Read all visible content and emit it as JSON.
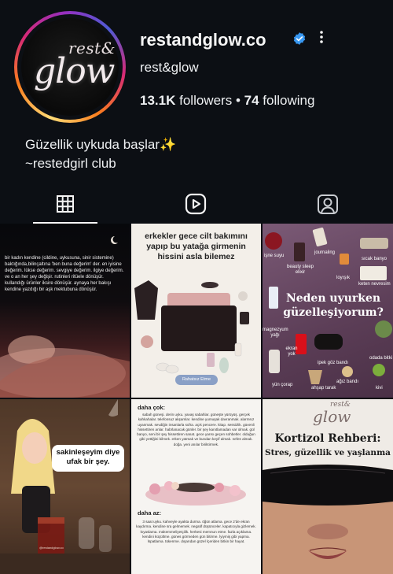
{
  "profile": {
    "username": "restandglow.co",
    "display_name": "rest&glow",
    "followers_count": "13.1K",
    "followers_label": "followers",
    "following_count": "74",
    "following_label": "following",
    "bio_line1": "Güzellik uykuda başlar✨",
    "bio_line2": "~restedgirl club",
    "avatar_logo_top": "rest&",
    "avatar_logo_main": "glow"
  },
  "tabs": [
    {
      "icon": "grid-icon",
      "active": true
    },
    {
      "icon": "reels-icon",
      "active": false
    },
    {
      "icon": "tagged-icon",
      "active": false
    }
  ],
  "posts": {
    "p1_text": "bir kadın kendine (cildine, uykusuna, sinir sistemine) baktığında,bilinçaltına 'ben buna değerim' der. en iyisine değerim. lükse değerim. sevgiye değerim. ilgiye değerim. ve o an her şey değişir. rutinleri ritüele dönüşür. kullandığı ürünler iksire dönüşür. aynaya her bakışı kendine yazdığı bir aşk mektubuna dönüşür.",
    "p2_title": "erkekler gece cilt bakımını yapıp bu yatağa girmenin hissini asla bilemez",
    "p2_button": "Rahatsız Etme",
    "p3_title": "Neden uyurken güzelleşiyorum?",
    "p3_labels": [
      "işne suyu",
      "journaling",
      "sıcak banyo",
      "beauty sleep elixir",
      "loyışık",
      "keten nevresim",
      "magnezyum yağı",
      "ekran yok",
      "ipek göz bandı",
      "odada bitki",
      "yün çorap",
      "ahşap tarak",
      "ağız bandı",
      "kivi"
    ],
    "p4_bubble": "sakinleşeyim diye ufak bir şey.",
    "p4_watermark": "@restandglow.co",
    "p5_heading1": "daha çok:",
    "p5_text1": "sabah güneşi. derin uyku. yavaş sabahlar. güneşte yürüyüş. gerçek kahkahalar. telefonsuz akşamlar. kendine yumuşak davranmak. alarmsız uyanmak. sevdiğin insanlarla sofra. açık pencere. kitap. sessizlik. güvenli hissettiren anlar. habrlanacak günler. bir şey kanıtlamadan var olmak. gül banyo, seni bir şey hissettiren sanat. gece yarısı geçen sohbetler. olduğun gibi yettiğini bilmek. erken yatmak ve bundan keyif almak. nefes almak. doğa. yeni anılar biriktirmek.",
    "p5_heading2": "daha az:",
    "p5_text2": "3 saat uyku. kahveyle ayakta durma. öğün atlama. gece 2'de ekran kaydırma. kendine sra gelmemek. negatif düşünceler. kapatıcıyla gizlemek. kıyaslama. mükemmeliyetçilik. herkesi memnun etme. fazla açıklama. kendini küçültme. günes görmeden gün bitirme. İyiymiş gibi yapma. İspatlama. tükenme. dışarıdan güzel İçeriden bitkin bir hayat.",
    "p6_logo_top": "rest&",
    "p6_logo_main": "glow",
    "p6_title": "Kortizol Rehberi:",
    "p6_subtitle": "Stres, güzellik ve yaşlanma"
  },
  "colors": {
    "background": "#0c0f14",
    "text": "#f3f5f7",
    "verified": "#3897f0",
    "p2_bg": "#f3efe9",
    "p3_bg": "#6b4a67",
    "p6_bg": "#efebe6"
  }
}
